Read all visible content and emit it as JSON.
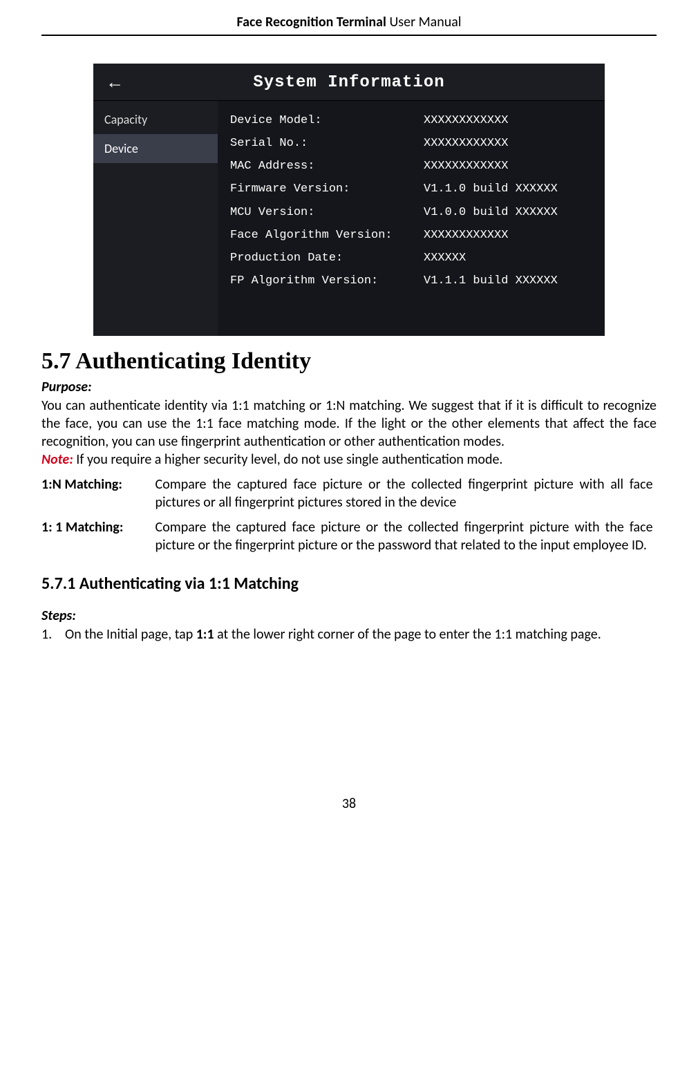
{
  "header": {
    "title_bold": "Face Recognition Terminal",
    "title_light": "  User Manual"
  },
  "device_ui": {
    "title": "System Information",
    "back_glyph": "←",
    "sidebar": [
      {
        "label": "Capacity",
        "active": false
      },
      {
        "label": "Device",
        "active": true
      }
    ],
    "rows": [
      {
        "label": "Device Model:",
        "value": "XXXXXXXXXXXX"
      },
      {
        "label": "Serial No.:",
        "value": "XXXXXXXXXXXX"
      },
      {
        "label": "MAC Address:",
        "value": "XXXXXXXXXXXX"
      },
      {
        "label": "Firmware Version:",
        "value": "V1.1.0 build XXXXXX"
      },
      {
        "label": "MCU Version:",
        "value": "V1.0.0 build XXXXXX"
      },
      {
        "label": "Face Algorithm Version:",
        "value": "XXXXXXXXXXXX"
      },
      {
        "label": "Production Date:",
        "value": "XXXXXX"
      },
      {
        "label": "FP Algorithm Version:",
        "value": "V1.1.1 build XXXXXX"
      }
    ]
  },
  "section": {
    "heading": "5.7  Authenticating Identity",
    "purpose_label": "Purpose:",
    "purpose_text": "You can authenticate identity via 1:1 matching or 1:N matching. We suggest that if it is difficult to recognize the face, you can use the 1:1 face matching mode. If the light or the other elements that affect the face recognition, you can use fingerprint authentication or other authentication modes.",
    "note_label": "Note:",
    "note_text": " If you require a higher security level, do not use single authentication mode.",
    "defs": [
      {
        "term": "1:N Matching:",
        "def": "Compare the captured face picture or the collected fingerprint picture with all face pictures or all fingerprint pictures stored in the device"
      },
      {
        "term": "1: 1 Matching:",
        "def": "Compare the captured face picture or the collected fingerprint picture with the face picture or the fingerprint picture or the password that related to the input employee ID."
      }
    ],
    "subheading": "5.7.1   Authenticating via 1:1 Matching",
    "steps_label": "Steps:",
    "steps": [
      {
        "num": "1.",
        "text_before": "On the Initial page, tap ",
        "bold": "1:1",
        "text_after": " at the lower right corner of the page to enter the 1:1 matching page."
      }
    ]
  },
  "page_number": "38"
}
